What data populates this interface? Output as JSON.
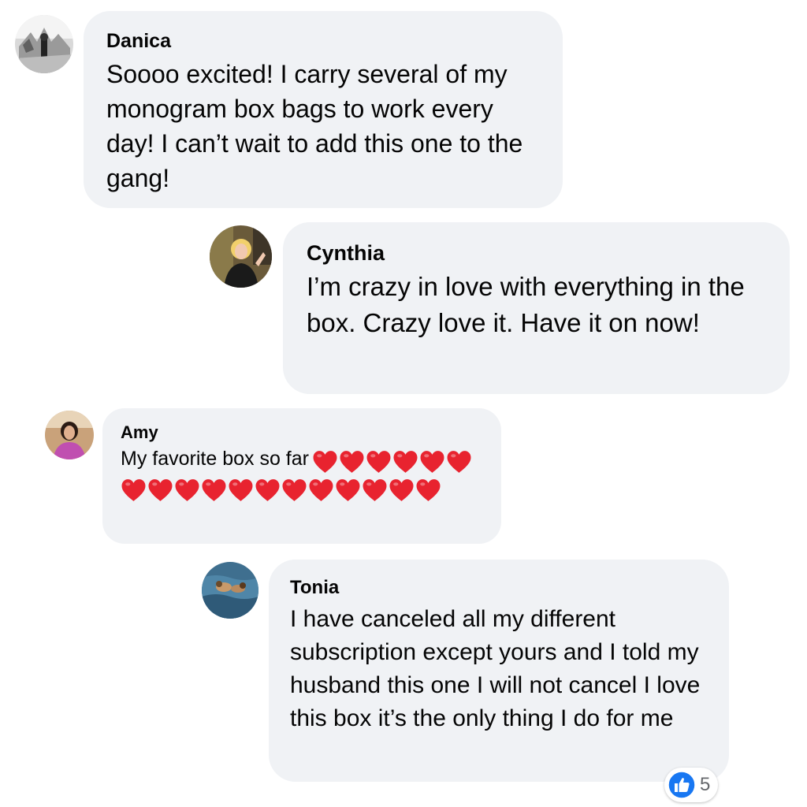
{
  "comments": [
    {
      "name": "Danica",
      "text": "Soooo excited! I carry several of my monogram box bags to work every day! I can’t wait to add this one to the gang!"
    },
    {
      "name": "Cynthia",
      "text": "I’m crazy in love with everything in the box. Crazy love it. Have it on now!"
    },
    {
      "name": "Amy",
      "text": "My favorite box so far",
      "emoji_name": "red-heart-icon",
      "emoji_count": 18
    },
    {
      "name": "Tonia",
      "text": "I have canceled all my different subscription except yours and I told my husband this one I will not cancel I love this box it’s the only thing I do for me"
    }
  ],
  "reactions": {
    "icon": "thumbs-up-icon",
    "count": "5"
  },
  "colors": {
    "bubble": "#f0f2f5",
    "text": "#050505",
    "like_blue": "#1877f2",
    "heart_red": "#e8232f",
    "count_gray": "#65676b"
  }
}
